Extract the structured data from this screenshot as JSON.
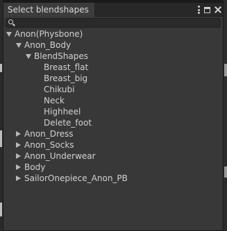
{
  "window": {
    "tab_title": "Select blendshapes"
  },
  "search": {
    "value": "",
    "placeholder": ""
  },
  "tree": [
    {
      "label": "Anon(Physbone)",
      "state": "expanded",
      "depth": 0
    },
    {
      "label": "Anon_Body",
      "state": "expanded",
      "depth": 1
    },
    {
      "label": "BlendShapes",
      "state": "expanded",
      "depth": 2
    },
    {
      "label": "Breast_flat",
      "state": "leaf",
      "depth": 3
    },
    {
      "label": "Breast_big",
      "state": "leaf",
      "depth": 3
    },
    {
      "label": "Chikubi",
      "state": "leaf",
      "depth": 3
    },
    {
      "label": "Neck",
      "state": "leaf",
      "depth": 3
    },
    {
      "label": "Highheel",
      "state": "leaf",
      "depth": 3
    },
    {
      "label": "Delete_foot",
      "state": "leaf",
      "depth": 3
    },
    {
      "label": "Anon_Dress",
      "state": "collapsed",
      "depth": 1
    },
    {
      "label": "Anon_Socks",
      "state": "collapsed",
      "depth": 1
    },
    {
      "label": "Anon_Underwear",
      "state": "collapsed",
      "depth": 1
    },
    {
      "label": "Body",
      "state": "collapsed",
      "depth": 1
    },
    {
      "label": "SailorOnepiece_Anon_PB",
      "state": "collapsed",
      "depth": 1
    }
  ],
  "colors": {
    "window_bg": "#383838",
    "text": "#d2d2d2",
    "arrow": "#b9b9b9"
  }
}
